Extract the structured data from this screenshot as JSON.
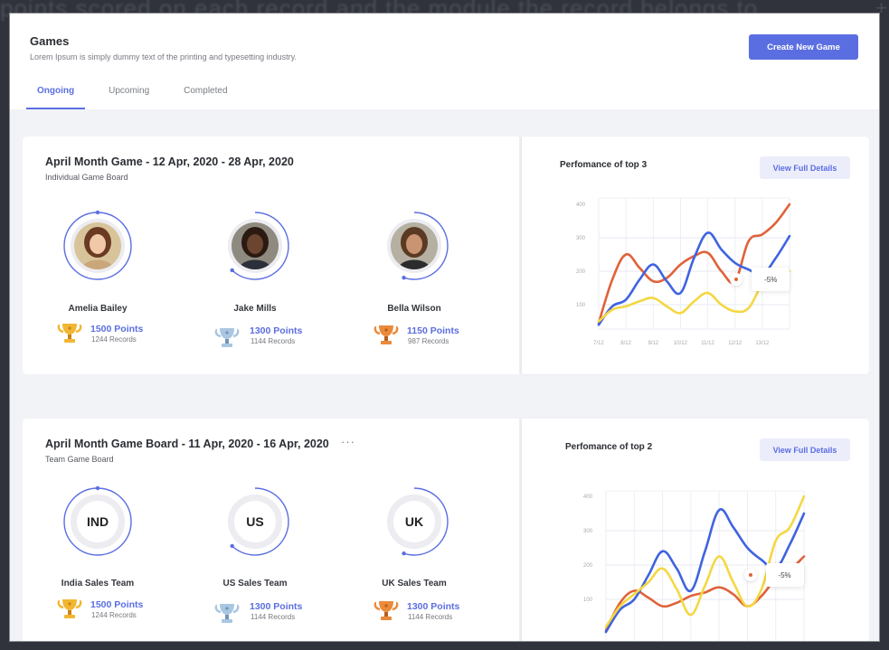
{
  "background": {
    "text": "points scored on each record and the module the record belongs to.",
    "plus": "+"
  },
  "header": {
    "title": "Games",
    "subtitle": "Lorem Ipsum is simply dummy text of the printing and typesetting industry.",
    "create_button": "Create New Game",
    "tabs": [
      {
        "label": "Ongoing",
        "active": true
      },
      {
        "label": "Upcoming",
        "active": false
      },
      {
        "label": "Completed",
        "active": false
      }
    ]
  },
  "colors": {
    "accent": "#5b6ee1",
    "series_blue": "#3f63e0",
    "series_orange": "#e0623a",
    "series_yellow": "#f5d742",
    "gold": "#e9a21f",
    "silver": "#8fb0cf",
    "bronze": "#d9792e"
  },
  "games": [
    {
      "title": "April Month Game  - 12 Apr, 2020 -  28 Apr, 2020",
      "subtitle": "Individual Game Board",
      "has_more_menu": false,
      "participants": [
        {
          "name": "Amelia Bailey",
          "points": "1500 Points",
          "records": "1244 Records",
          "trophy": "gold-trophy-icon",
          "progress": 1.0,
          "avatar": "avatar-amelia"
        },
        {
          "name": "Jake Mills",
          "points": "1300 Points",
          "records": "1144 Records",
          "trophy": "silver-trophy-icon",
          "progress": 0.62,
          "avatar": "avatar-jake"
        },
        {
          "name": "Bella Wilson",
          "points": "1150 Points",
          "records": "987 Records",
          "trophy": "bronze-trophy-icon",
          "progress": 0.55,
          "avatar": "avatar-bella"
        }
      ],
      "chart": {
        "title": "Perfomance of top 3",
        "button": "View Full Details",
        "tooltip": "-5%"
      }
    },
    {
      "title": "April Month Game Board - 11 Apr, 2020 -  16 Apr, 2020",
      "subtitle": "Team Game Board",
      "has_more_menu": true,
      "more_label": "···",
      "participants": [
        {
          "name": "India Sales Team",
          "code": "IND",
          "points": "1500 Points",
          "records": "1244 Records",
          "trophy": "gold-trophy-icon",
          "progress": 1.0
        },
        {
          "name": "US Sales Team",
          "code": "US",
          "points": "1300 Points",
          "records": "1144 Records",
          "trophy": "silver-trophy-icon",
          "progress": 0.62
        },
        {
          "name": "UK Sales Team",
          "code": "UK",
          "points": "1300 Points",
          "records": "1144 Records",
          "trophy": "bronze-trophy-icon",
          "progress": 0.55
        }
      ],
      "chart": {
        "title": "Perfomance of top 2",
        "button": "View Full Details",
        "tooltip": "-5%"
      }
    }
  ],
  "chart_data": [
    {
      "type": "line",
      "title": "Perfomance of top 3",
      "categories": [
        "7/12",
        "8/12",
        "9/12",
        "10/12",
        "11/12",
        "12/12",
        "13/12"
      ],
      "x": [
        0,
        0.5,
        1,
        1.5,
        2,
        2.5,
        3,
        3.5,
        4,
        4.5,
        5,
        5.5,
        6,
        6.5,
        7
      ],
      "yticks": [
        100,
        200,
        300,
        400
      ],
      "ylim": [
        27,
        420
      ],
      "grid": true,
      "annotation": {
        "label": "-5%",
        "x": 5.05,
        "y": 175
      },
      "series": [
        {
          "name": "orange",
          "color": "#e0623a",
          "values": [
            45,
            175,
            250,
            210,
            170,
            180,
            220,
            245,
            255,
            200,
            170,
            290,
            310,
            345,
            400
          ]
        },
        {
          "name": "blue",
          "color": "#3f63e0",
          "values": [
            40,
            95,
            115,
            175,
            220,
            170,
            135,
            240,
            315,
            265,
            225,
            205,
            190,
            240,
            305
          ]
        },
        {
          "name": "yellow",
          "color": "#f5d742",
          "values": [
            50,
            85,
            95,
            110,
            120,
            95,
            75,
            110,
            135,
            100,
            80,
            90,
            160,
            185,
            200
          ]
        }
      ]
    },
    {
      "type": "line",
      "title": "Perfomance of top 2",
      "categories": [],
      "x": [
        0,
        0.5,
        1,
        1.5,
        2,
        2.5,
        3,
        3.5,
        4,
        4.5,
        5,
        5.5,
        6,
        6.5,
        7
      ],
      "yticks": [
        100,
        200,
        300,
        400
      ],
      "ylim": [
        0,
        420
      ],
      "grid": true,
      "annotation": {
        "label": "-5%",
        "x": 5.1,
        "y": 170
      },
      "series": [
        {
          "name": "orange",
          "color": "#e0623a",
          "values": [
            10,
            90,
            125,
            105,
            80,
            90,
            110,
            120,
            135,
            115,
            80,
            110,
            160,
            185,
            225
          ]
        },
        {
          "name": "blue",
          "color": "#3f63e0",
          "values": [
            5,
            70,
            100,
            170,
            240,
            190,
            125,
            240,
            360,
            310,
            250,
            215,
            190,
            260,
            350
          ]
        },
        {
          "name": "yellow",
          "color": "#f5d742",
          "values": [
            20,
            80,
            115,
            150,
            190,
            130,
            55,
            140,
            225,
            150,
            80,
            130,
            270,
            310,
            400
          ]
        }
      ]
    }
  ]
}
